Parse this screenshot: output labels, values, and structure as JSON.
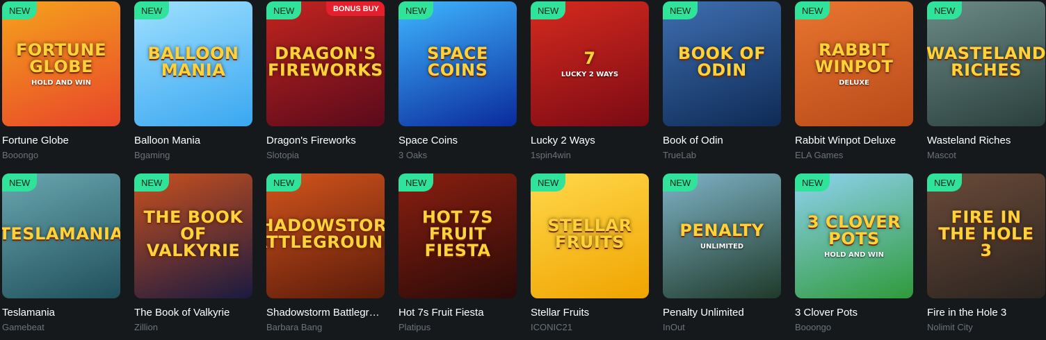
{
  "badges": {
    "new": "NEW",
    "bonus_buy": "BONUS BUY"
  },
  "games": [
    {
      "title": "Fortune Globe",
      "provider": "Booongo",
      "logo": "Fortune Globe",
      "sub": "Hold and Win",
      "bg": "#e8452a",
      "bg2": "#f5a21c",
      "new": "NEW"
    },
    {
      "title": "Balloon Mania",
      "provider": "Bgaming",
      "logo": "Balloon Mania",
      "sub": "",
      "bg": "#3aa7f0",
      "bg2": "#9ee0ff",
      "new": "NEW"
    },
    {
      "title": "Dragon's Fireworks",
      "provider": "Slotopia",
      "logo": "Dragon's Fireworks",
      "sub": "",
      "bg": "#5a0a1c",
      "bg2": "#c2241e",
      "new": "NEW",
      "bonus": "BONUS BUY"
    },
    {
      "title": "Space Coins",
      "provider": "3 Oaks",
      "logo": "Space Coins",
      "sub": "",
      "bg": "#0a2a9c",
      "bg2": "#3fb6ff",
      "new": "NEW"
    },
    {
      "title": "Lucky 2 Ways",
      "provider": "1spin4win",
      "logo": "7",
      "sub": "Lucky 2 Ways",
      "bg": "#7a0a14",
      "bg2": "#d62a1e",
      "new": "NEW"
    },
    {
      "title": "Book of Odin",
      "provider": "TrueLab",
      "logo": "Book of Odin",
      "sub": "",
      "bg": "#0e2a55",
      "bg2": "#3e6fb0",
      "new": "NEW"
    },
    {
      "title": "Rabbit Winpot Deluxe",
      "provider": "ELA Games",
      "logo": "Rabbit Winpot",
      "sub": "Deluxe",
      "bg": "#b84a1a",
      "bg2": "#e9752e",
      "new": "NEW"
    },
    {
      "title": "Wasteland Riches",
      "provider": "Mascot",
      "logo": "Wasteland Riches",
      "sub": "",
      "bg": "#2a3f3c",
      "bg2": "#6b8a86",
      "new": "NEW"
    },
    {
      "title": "Teslamania",
      "provider": "Gamebeat",
      "logo": "Teslamania",
      "sub": "",
      "bg": "#1f4f5a",
      "bg2": "#6aa7b0",
      "new": "NEW"
    },
    {
      "title": "The Book of Valkyrie",
      "provider": "Zillion",
      "logo": "The Book of Valkyrie",
      "sub": "",
      "bg": "#1a1a40",
      "bg2": "#c8501e",
      "new": "NEW"
    },
    {
      "title": "Shadowstorm Battlegrounds",
      "provider": "Barbara Bang",
      "logo": "Shadowstorm Battlegrounds",
      "sub": "",
      "bg": "#5a1a0a",
      "bg2": "#d2541c",
      "new": "NEW"
    },
    {
      "title": "Hot 7s Fruit Fiesta",
      "provider": "Platipus",
      "logo": "Hot 7s Fruit Fiesta",
      "sub": "",
      "bg": "#2a0a08",
      "bg2": "#8a1f10",
      "new": "NEW"
    },
    {
      "title": "Stellar Fruits",
      "provider": "ICONIC21",
      "logo": "Stellar Fruits",
      "sub": "",
      "bg": "#f0a400",
      "bg2": "#ffd84a",
      "new": "NEW"
    },
    {
      "title": "Penalty Unlimited",
      "provider": "InOut",
      "logo": "Penalty",
      "sub": "Unlimited",
      "bg": "#1f3a2a",
      "bg2": "#7fb3c7",
      "new": "NEW"
    },
    {
      "title": "3 Clover Pots",
      "provider": "Booongo",
      "logo": "3 Clover Pots",
      "sub": "Hold and Win",
      "bg": "#2f9a3a",
      "bg2": "#8fd2f0",
      "new": "NEW"
    },
    {
      "title": "Fire in the Hole 3",
      "provider": "Nolimit City",
      "logo": "Fire in the Hole 3",
      "sub": "",
      "bg": "#2b2420",
      "bg2": "#6a4a38",
      "new": "NEW"
    }
  ]
}
